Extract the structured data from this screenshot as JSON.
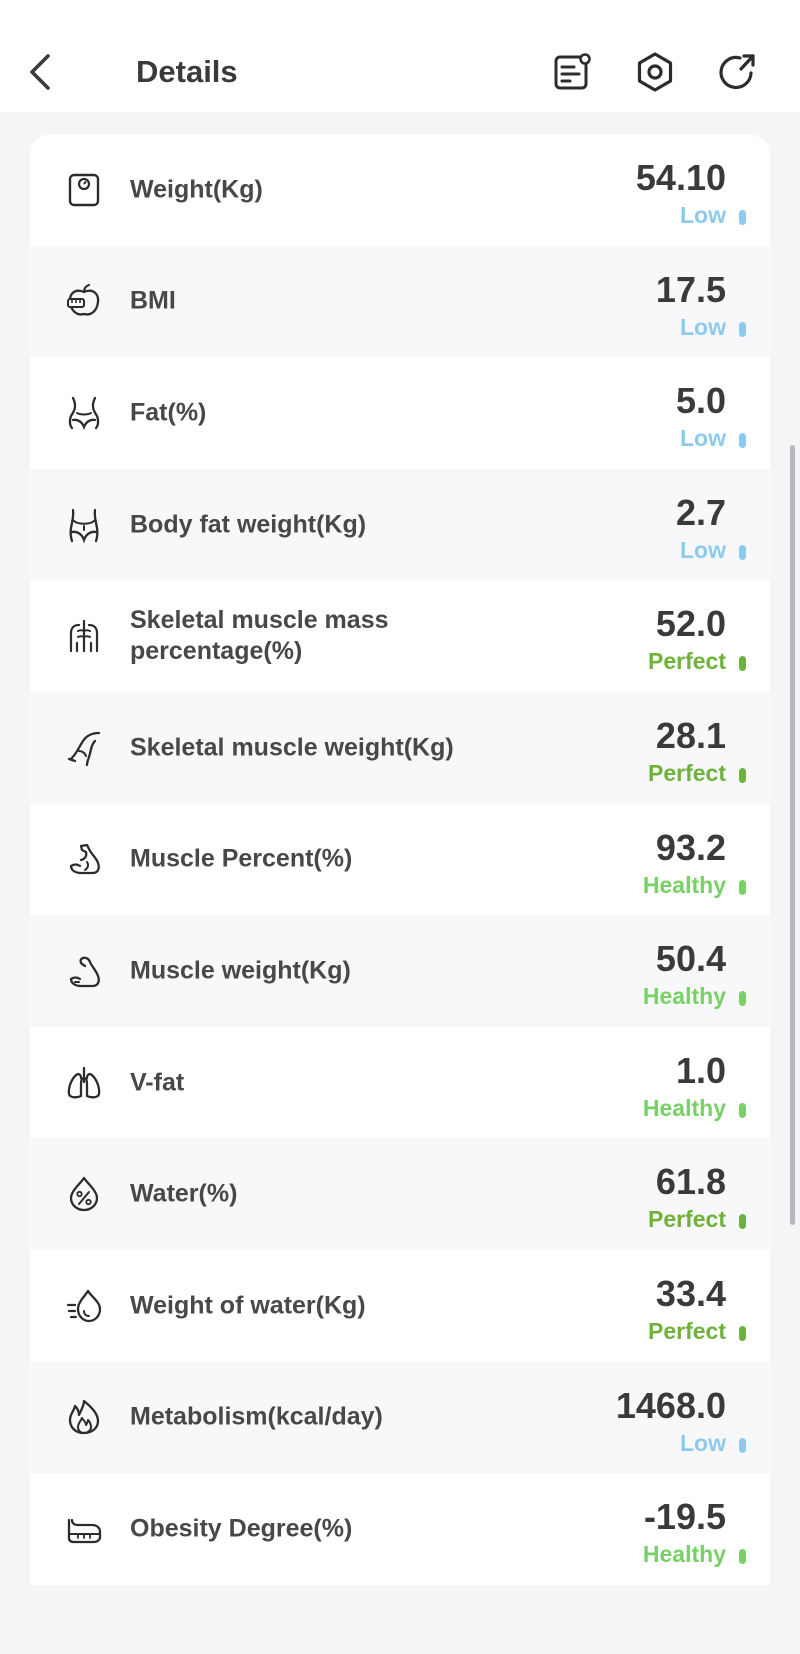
{
  "header": {
    "title": "Details"
  },
  "colors": {
    "low": "#8ccbee",
    "perfect": "#6fb23b",
    "healthy": "#77d165"
  },
  "items": [
    {
      "label": "Weight(Kg)",
      "value": "54.10",
      "status": "Low",
      "icon": "scale-icon"
    },
    {
      "label": "BMI",
      "value": "17.5",
      "status": "Low",
      "icon": "apple-tape-icon"
    },
    {
      "label": "Fat(%)",
      "value": "5.0",
      "status": "Low",
      "icon": "waist-icon"
    },
    {
      "label": "Body fat weight(Kg)",
      "value": "2.7",
      "status": "Low",
      "icon": "body-fat-icon"
    },
    {
      "label": "Skeletal muscle mass percentage(%)",
      "value": "52.0",
      "status": "Perfect",
      "icon": "skeleton-icon"
    },
    {
      "label": "Skeletal muscle weight(Kg)",
      "value": "28.1",
      "status": "Perfect",
      "icon": "leg-muscle-icon"
    },
    {
      "label": "Muscle Percent(%)",
      "value": "93.2",
      "status": "Healthy",
      "icon": "bicep-icon"
    },
    {
      "label": "Muscle weight(Kg)",
      "value": "50.4",
      "status": "Healthy",
      "icon": "arm-muscle-icon"
    },
    {
      "label": "V-fat",
      "value": "1.0",
      "status": "Healthy",
      "icon": "lungs-icon"
    },
    {
      "label": "Water(%)",
      "value": "61.8",
      "status": "Perfect",
      "icon": "water-percent-icon"
    },
    {
      "label": "Weight of water(Kg)",
      "value": "33.4",
      "status": "Perfect",
      "icon": "water-drop-icon"
    },
    {
      "label": "Metabolism(kcal/day)",
      "value": "1468.0",
      "status": "Low",
      "icon": "flame-icon"
    },
    {
      "label": "Obesity Degree(%)",
      "value": "-19.5",
      "status": "Healthy",
      "icon": "belly-icon"
    }
  ]
}
